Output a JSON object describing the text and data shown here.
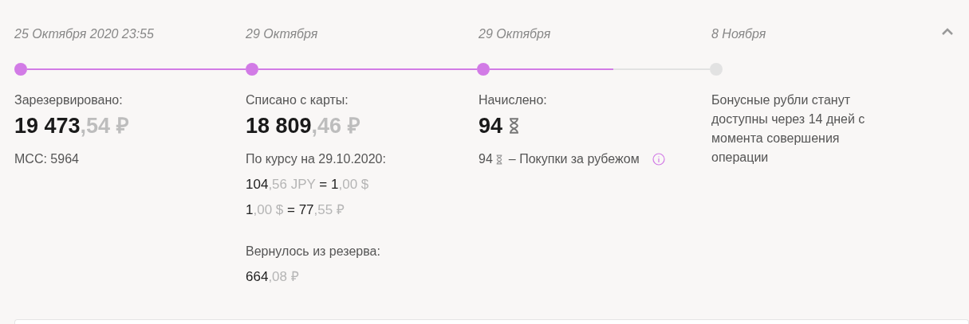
{
  "timeline": {
    "level": 0.56,
    "steps": [
      {
        "date": "25 Октября 2020 23:55",
        "done": true
      },
      {
        "date": "29 Октября",
        "done": true
      },
      {
        "date": "29 Октября",
        "done": true
      },
      {
        "date": "8 Ноября",
        "done": false
      }
    ]
  },
  "columns": [
    {
      "label": "Зарезервировано:",
      "amount": {
        "kind": "money",
        "whole": "19 473",
        "fraction": ",54 ₽"
      },
      "details": [
        {
          "kind": "note",
          "text": "MCC: 5964"
        }
      ]
    },
    {
      "label": "Списано с карты:",
      "amount": {
        "kind": "money",
        "whole": "18 809",
        "fraction": ",46 ₽"
      },
      "details": [
        {
          "kind": "note",
          "text": "По курсу на 29.10.2020:"
        },
        {
          "kind": "rate",
          "parts": [
            {
              "text": "104",
              "muted": false
            },
            {
              "text": ",56 JPY",
              "muted": true
            },
            {
              "text": " = ",
              "muted": false
            },
            {
              "text": "1",
              "muted": false
            },
            {
              "text": ",00 $",
              "muted": true
            }
          ]
        },
        {
          "kind": "rate",
          "parts": [
            {
              "text": "1",
              "muted": false
            },
            {
              "text": ",00 $",
              "muted": true
            },
            {
              "text": " = ",
              "muted": false
            },
            {
              "text": "77",
              "muted": false
            },
            {
              "text": ",55 ₽",
              "muted": true
            }
          ]
        },
        {
          "kind": "note",
          "text": "Вернулось из резерва:"
        },
        {
          "kind": "rate",
          "parts": [
            {
              "text": "664",
              "muted": false
            },
            {
              "text": ",08 ₽",
              "muted": true
            }
          ]
        }
      ]
    },
    {
      "label": "Начислено:",
      "amount": {
        "kind": "bonus",
        "whole": "94"
      },
      "details": [
        {
          "kind": "bonus",
          "value": "94",
          "text": "– Покупки за рубежом"
        }
      ]
    },
    {
      "details": [
        {
          "kind": "paragraph",
          "text": "Бонусные рубли станут доступны через 14 дней с момента совершения операции"
        }
      ]
    }
  ]
}
